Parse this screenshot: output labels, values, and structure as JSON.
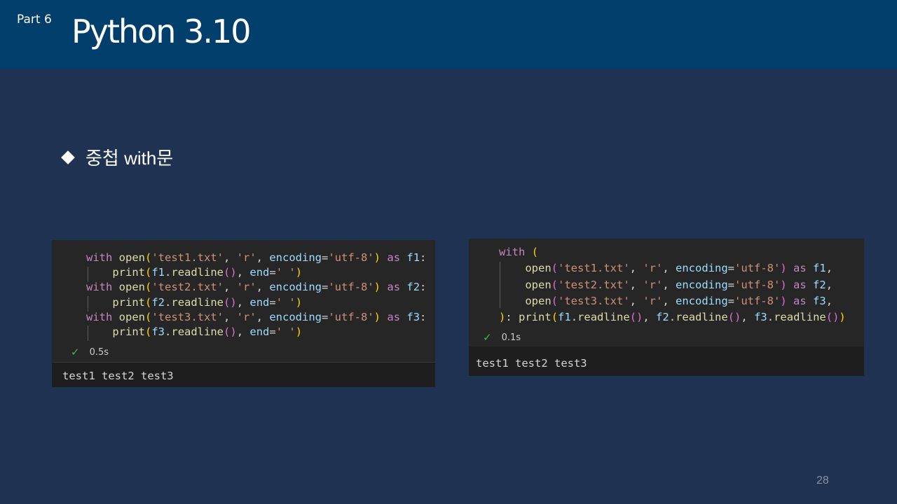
{
  "header": {
    "part": "Part 6",
    "title": "Python 3.10"
  },
  "bullet": {
    "text": "중첩 with문"
  },
  "panel_left": {
    "code": [
      "with open('test1.txt', 'r', encoding='utf-8') as f1:",
      "    print(f1.readline(), end=' ')",
      "with open('test2.txt', 'r', encoding='utf-8') as f2:",
      "    print(f2.readline(), end=' ')",
      "with open('test3.txt', 'r', encoding='utf-8') as f3:",
      "    print(f3.readline(), end=' ')"
    ],
    "exec_time": "0.5s",
    "output": "test1 test2 test3"
  },
  "panel_right": {
    "code": [
      "with (",
      "    open('test1.txt', 'r', encoding='utf-8') as f1,",
      "    open('test2.txt', 'r', encoding='utf-8') as f2,",
      "    open('test3.txt', 'r', encoding='utf-8') as f3,",
      "): print(f1.readline(), f2.readline(), f3.readline())"
    ],
    "exec_time": "0.1s",
    "output": "test1 test2 test3"
  },
  "page_number": "28",
  "colors": {
    "background": "#1f3251",
    "header": "#003f6b",
    "keyword": "#c586c0",
    "function": "#dcdcaa",
    "string": "#ce9178",
    "variable": "#9cdcfe",
    "success_check": "#3fb950"
  },
  "icons": {
    "status": "check-icon",
    "bullet": "diamond-icon"
  }
}
